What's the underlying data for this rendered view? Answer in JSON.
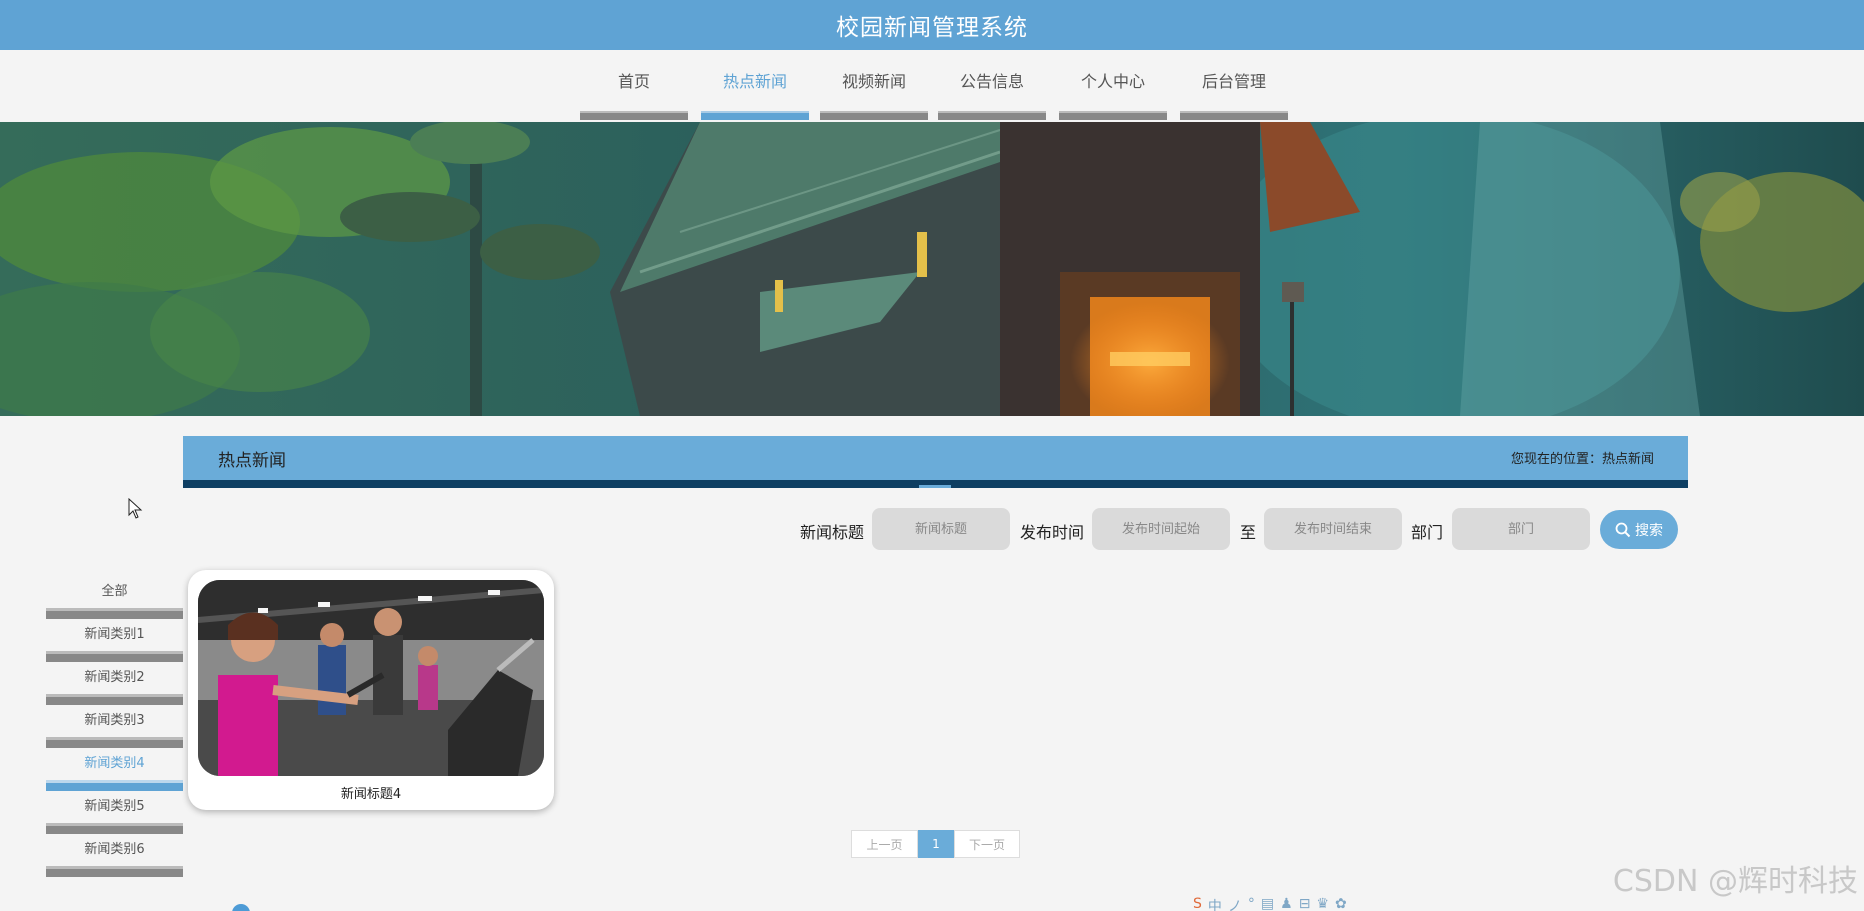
{
  "app": {
    "title": "校园新闻管理系统"
  },
  "nav": {
    "items": [
      {
        "label": "首页"
      },
      {
        "label": "热点新闻"
      },
      {
        "label": "视频新闻"
      },
      {
        "label": "公告信息"
      },
      {
        "label": "个人中心"
      },
      {
        "label": "后台管理"
      }
    ],
    "active": "热点新闻"
  },
  "section": {
    "title": "热点新闻",
    "location": "您现在的位置：热点新闻"
  },
  "search": {
    "title_label": "新闻标题",
    "title_placeholder": "新闻标题",
    "date_label": "发布时间",
    "date_start_placeholder": "发布时间起始",
    "to_label": "至",
    "date_end_placeholder": "发布时间结束",
    "dept_label": "部门",
    "dept_placeholder": "部门",
    "button_label": "搜索",
    "button_icon": "search-icon"
  },
  "categories": {
    "items": [
      {
        "label": "全部"
      },
      {
        "label": "新闻类别1"
      },
      {
        "label": "新闻类别2"
      },
      {
        "label": "新闻类别3"
      },
      {
        "label": "新闻类别4"
      },
      {
        "label": "新闻类别5"
      },
      {
        "label": "新闻类别6"
      }
    ],
    "active": "新闻类别4"
  },
  "news": {
    "items": [
      {
        "title": "新闻标题4",
        "image": "gym-photo"
      }
    ]
  },
  "pagination": {
    "prev": "上一页",
    "current": "1",
    "next": "下一页"
  },
  "watermark": "CSDN @辉时科技",
  "tray": {
    "icons": [
      "S",
      "中",
      "ノ",
      "°",
      "▤",
      "♟",
      "⊟",
      "♛",
      "✿"
    ]
  },
  "colors": {
    "primary": "#5fa3d4",
    "header_dark": "#0e3f63",
    "nav_bar": "#888888"
  }
}
